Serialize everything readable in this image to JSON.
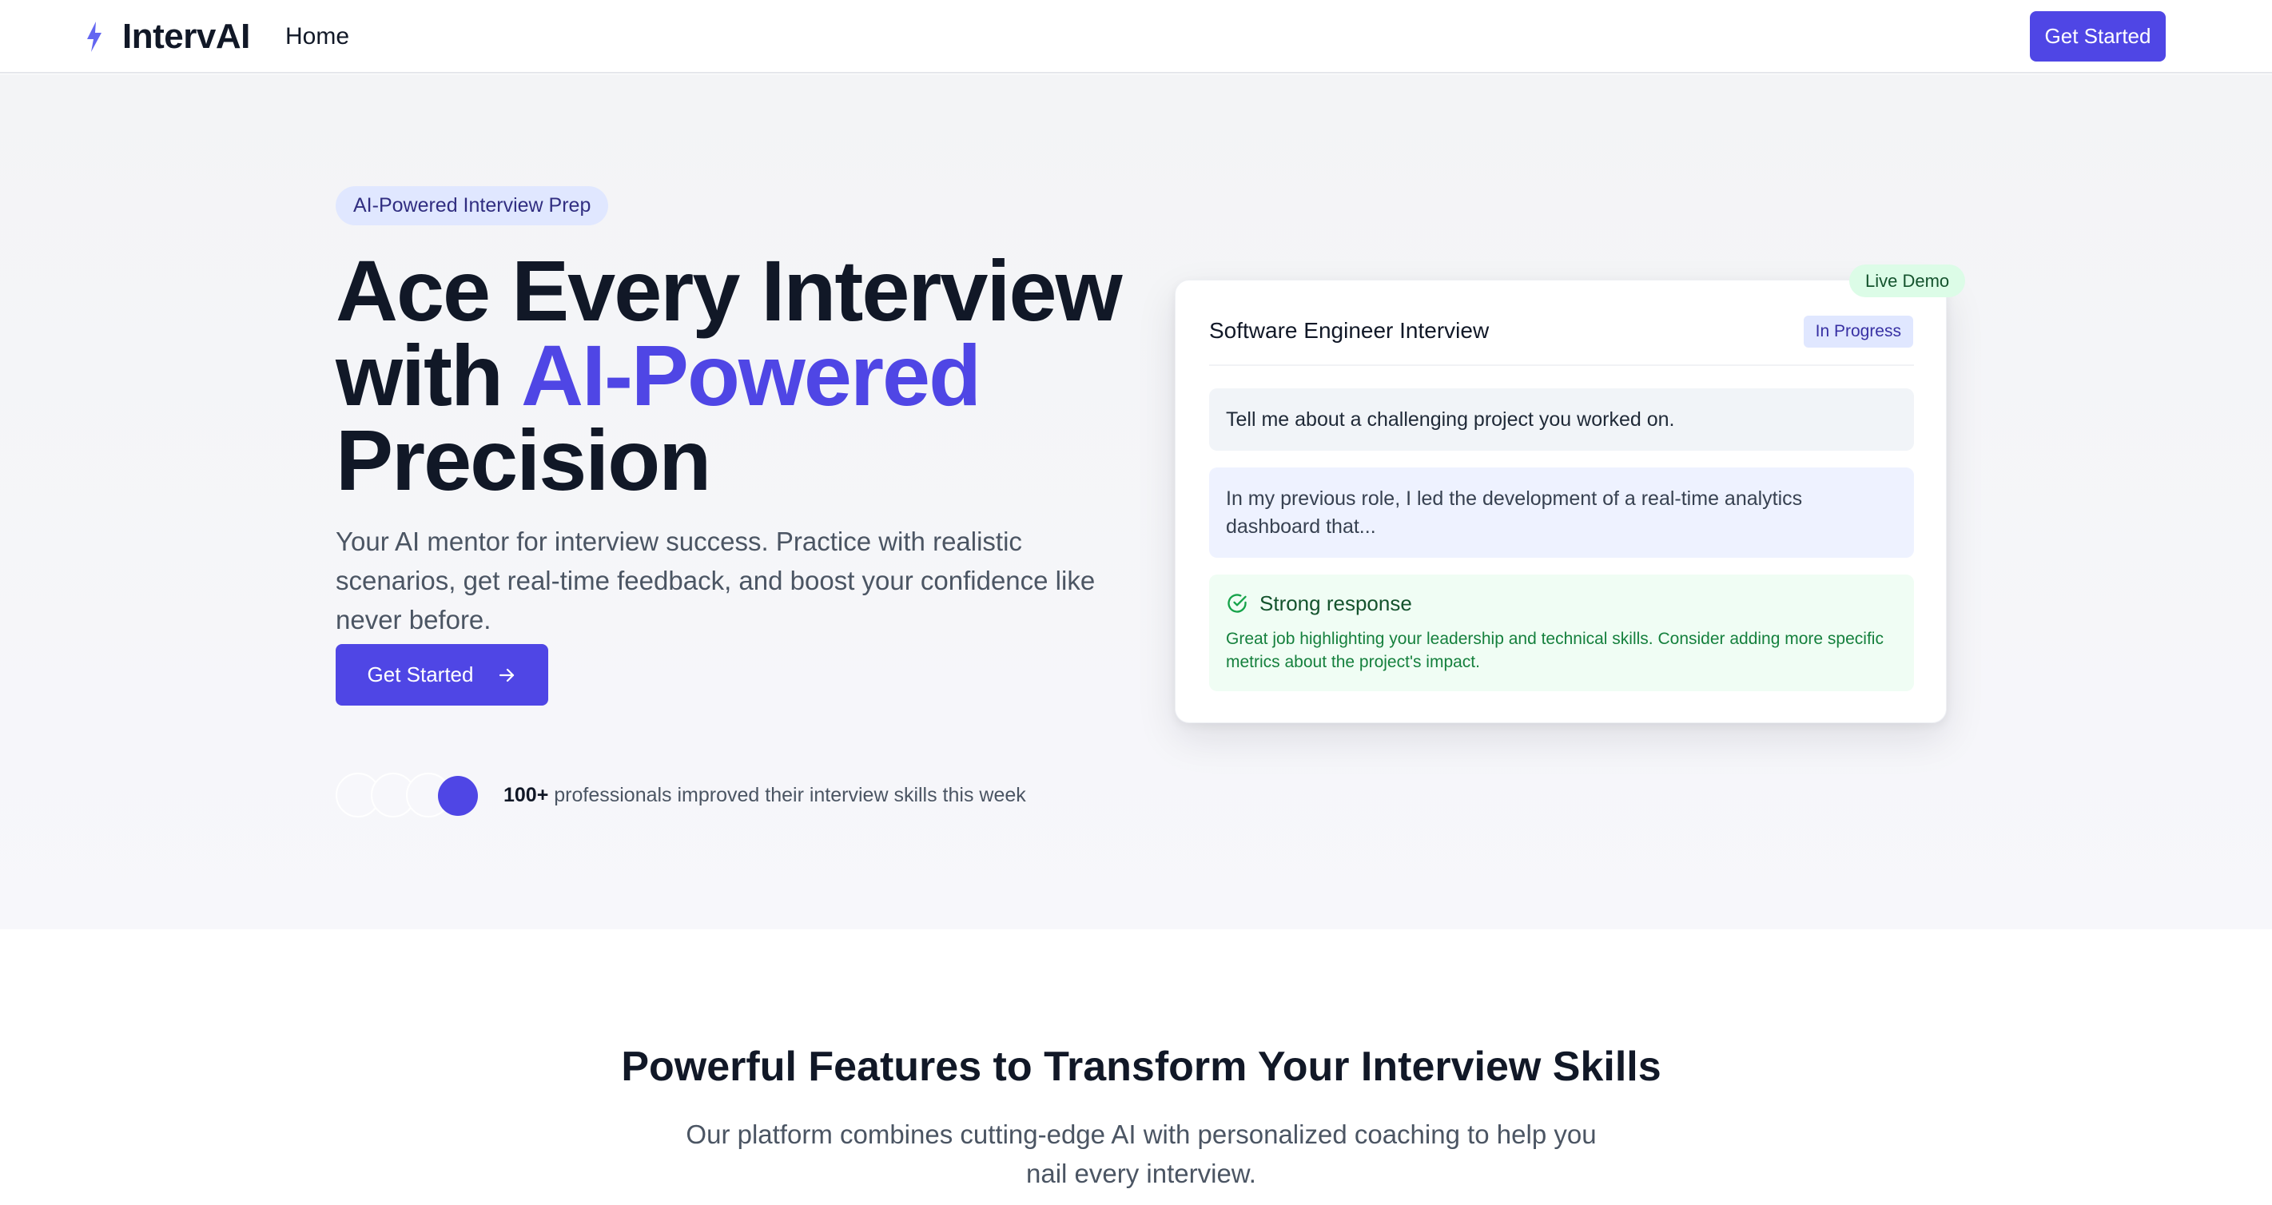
{
  "nav": {
    "brand": "IntervAI",
    "brand_icon": "lightning-bolt-icon",
    "links": [
      {
        "label": "Home"
      }
    ],
    "cta_label": "Get Started",
    "accent_color": "#4f46e5"
  },
  "hero": {
    "pill": "AI-Powered Interview Prep",
    "title_line1": "Ace Every Interview",
    "title_line2_prefix": "with ",
    "title_line2_accent": "AI-Powered",
    "title_line3": "Precision",
    "subtitle": "Your AI mentor for interview success. Practice with realistic scenarios, get real-time feedback, and boost your confidence like never before.",
    "cta_label": "Get Started",
    "cta_icon": "arrow-right-icon",
    "social_proof_count": "100+",
    "social_proof_text": " professionals improved their interview skills this week"
  },
  "demo": {
    "badge": "Live Demo",
    "title": "Software Engineer Interview",
    "status": "In Progress",
    "question": "Tell me about a challenging project you worked on.",
    "answer": "In my previous role, I led the development of a real-time analytics dashboard that...",
    "feedback_title": "Strong response",
    "feedback_icon": "check-circle-icon",
    "feedback_text": "Great job highlighting your leadership and technical skills. Consider adding more specific metrics about the project's impact."
  },
  "features": {
    "title": "Powerful Features to Transform Your Interview Skills",
    "subtitle": "Our platform combines cutting-edge AI with personalized coaching to help you nail every interview."
  }
}
